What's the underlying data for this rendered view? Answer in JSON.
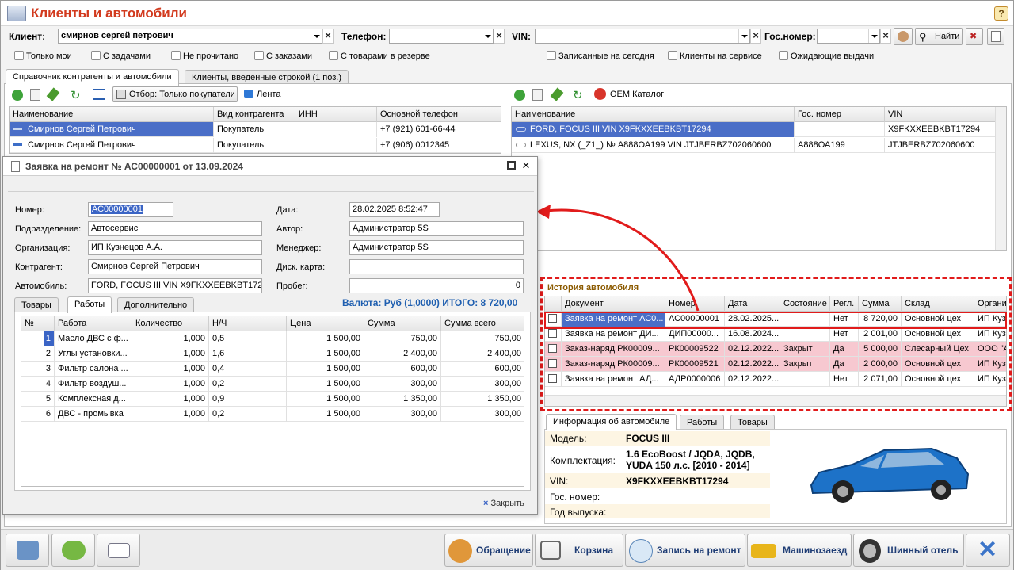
{
  "app": {
    "title": "Клиенты и автомобили",
    "help": "?"
  },
  "filters": {
    "client_label": "Клиент:",
    "client_value": "смирнов сергей петрович",
    "phone_label": "Телефон:",
    "phone_value": "",
    "vin_label": "VIN:",
    "vin_value": "",
    "plate_label": "Гос.номер:",
    "plate_value": "",
    "find_label": "Найти",
    "checks": [
      "Только мои",
      "С задачами",
      "Не прочитано",
      "С заказами",
      "С товарами в резерве",
      "Записанные на сегодня",
      "Клиенты на сервисе",
      "Ожидающие выдачи"
    ]
  },
  "tabs": [
    "Справочник контрагенты и автомобили",
    "Клиенты, введенные строкой (1 поз.)"
  ],
  "left_toolbar": {
    "filter_label": "Отбор: Только покупатели",
    "feed_label": "Лента"
  },
  "clients_grid": {
    "columns": [
      "Наименование",
      "Вид контрагента",
      "ИНН",
      "Основной телефон"
    ],
    "rows": [
      [
        "Смирнов Сергей Петрович",
        "Покупатель",
        "",
        "+7 (921) 601-66-44"
      ],
      [
        "Смирнов Сергей Петрович",
        "Покупатель",
        "",
        "+7 (906) 0012345"
      ]
    ]
  },
  "right_toolbar": {
    "oem_label": "OEM Каталог"
  },
  "cars_grid": {
    "columns": [
      "Наименование",
      "Гос. номер",
      "VIN"
    ],
    "rows": [
      [
        "FORD, FOCUS III VIN X9FKXXEEBKBT17294",
        "",
        "X9FKXXEEBKBT17294"
      ],
      [
        "LEXUS, NX (_Z1_) № А888ОА199 VIN JTJBERBZ702060600",
        "А888ОА199",
        "JTJBERBZ702060600"
      ]
    ]
  },
  "history": {
    "title": "История автомобиля",
    "columns": [
      "Документ",
      "Номер",
      "Дата",
      "Состояние",
      "Регл.",
      "Сумма",
      "Склад",
      "Органи"
    ],
    "rows": [
      [
        "Заявка на ремонт АС0...",
        "АС00000001",
        "28.02.2025...",
        "",
        "Нет",
        "8 720,00",
        "Основной цех",
        "ИП Куз"
      ],
      [
        "Заявка на ремонт ДИ...",
        "ДИП00000...",
        "16.08.2024...",
        "",
        "Нет",
        "2 001,00",
        "Основной цех",
        "ИП Куз"
      ],
      [
        "Заказ-наряд РК00009...",
        "РК00009522",
        "02.12.2022...",
        "Закрыт",
        "Да",
        "5 000,00",
        "Слесарный Цех",
        "ООО \"А"
      ],
      [
        "Заказ-наряд РК00009...",
        "РК00009521",
        "02.12.2022...",
        "Закрыт",
        "Да",
        "2 000,00",
        "Основной цех",
        "ИП Куз"
      ],
      [
        "Заявка на ремонт АД...",
        "АДР0000006",
        "02.12.2022...",
        "",
        "Нет",
        "2 071,00",
        "Основной цех",
        "ИП Куз"
      ]
    ]
  },
  "carinfo": {
    "tabs": [
      "Информация об автомобиле",
      "Работы",
      "Товары"
    ],
    "model_label": "Модель:",
    "model_value": "FOCUS III",
    "trim_label": "Комплектация:",
    "trim_value_1": "1.6 EcoBoost / JQDA, JQDB,",
    "trim_value_2": "YUDA 150 л.с. [2010 - 2014]",
    "vin_label": "VIN:",
    "vin_value": "X9FKXXEEBKBT17294",
    "plate_label": "Гос. номер:",
    "year_label": "Год выпуска:"
  },
  "dialog": {
    "title": "Заявка на ремонт № АС00000001 от 13.09.2024",
    "number_label": "Номер:",
    "number_value": "АС00000001",
    "date_label": "Дата:",
    "date_value": "28.02.2025  8:52:47",
    "dept_label": "Подразделение:",
    "dept_value": "Автосервис",
    "author_label": "Автор:",
    "author_value": "Администратор 5S",
    "org_label": "Организация:",
    "org_value": "ИП Кузнецов А.А.",
    "manager_label": "Менеджер:",
    "manager_value": "Администратор 5S",
    "contr_label": "Контрагент:",
    "contr_value": "Смирнов Сергей Петрович",
    "card_label": "Диск. карта:",
    "card_value": "",
    "car_label": "Автомобиль:",
    "car_value": "FORD, FOCUS III VIN X9FKXXEEBKBT17294",
    "mileage_label": "Пробег:",
    "mileage_value": "0",
    "currency_text": "Валюта: Руб (1,0000) ИТОГО: 8 720,00",
    "tabs": [
      "Товары",
      "Работы",
      "Дополнительно"
    ],
    "works_columns": [
      "№",
      "Работа",
      "Количество",
      "Н/Ч",
      "Цена",
      "Сумма",
      "Сумма всего"
    ],
    "works_rows": [
      [
        "1",
        "Масло ДВС с ф...",
        "1,000",
        "0,5",
        "1 500,00",
        "750,00",
        "750,00"
      ],
      [
        "2",
        "Углы установки...",
        "1,000",
        "1,6",
        "1 500,00",
        "2 400,00",
        "2 400,00"
      ],
      [
        "3",
        "Фильтр салона ...",
        "1,000",
        "0,4",
        "1 500,00",
        "600,00",
        "600,00"
      ],
      [
        "4",
        "Фильтр воздуш...",
        "1,000",
        "0,2",
        "1 500,00",
        "300,00",
        "300,00"
      ],
      [
        "5",
        "Комплексная д...",
        "1,000",
        "0,9",
        "1 500,00",
        "1 350,00",
        "1 350,00"
      ],
      [
        "6",
        "ДВС - промывка",
        "1,000",
        "0,2",
        "1 500,00",
        "300,00",
        "300,00"
      ]
    ],
    "close_label": "Закрыть"
  },
  "bottom": {
    "appeal": "Обращение",
    "cart": "Корзина",
    "booking": "Запись на ремонт",
    "carcall": "Машинозаезд",
    "tirehotel": "Шинный отель"
  },
  "colors": {
    "title": "#d23a1e",
    "selection": "#4a6ec7",
    "pink_row": "#f7c8d0",
    "highlight": "#e11b1b",
    "link_blue": "#1f5fb0"
  }
}
